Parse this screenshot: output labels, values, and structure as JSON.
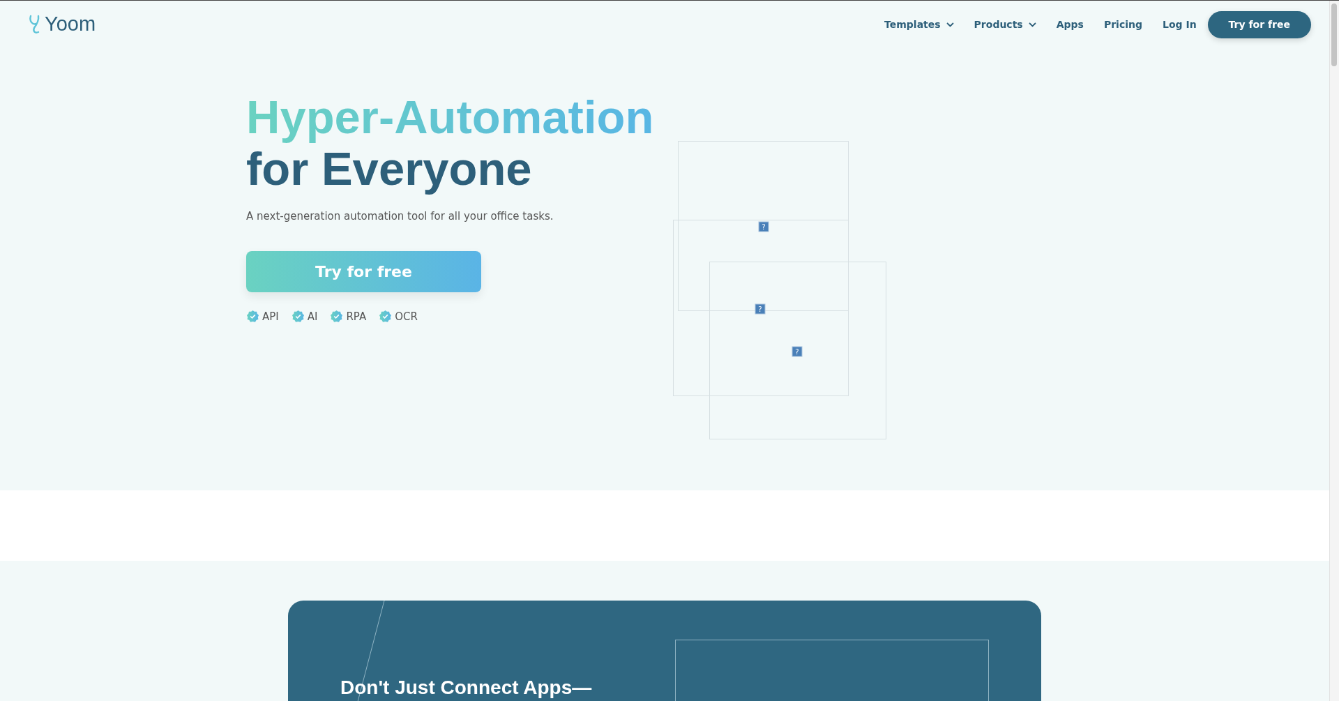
{
  "nav": {
    "logo": "Yoom",
    "links": [
      {
        "label": "Templates",
        "dropdown": true
      },
      {
        "label": "Products",
        "dropdown": true
      },
      {
        "label": "Apps",
        "dropdown": false
      },
      {
        "label": "Pricing",
        "dropdown": false
      },
      {
        "label": "Log In",
        "dropdown": false
      }
    ],
    "cta": "Try for free"
  },
  "hero": {
    "title_line1": "Hyper-Automation",
    "title_line2": "for Everyone",
    "subtitle": "A next-generation automation tool for all your office tasks.",
    "button": "Try for free",
    "features": [
      "API",
      "AI",
      "RPA",
      "OCR"
    ],
    "images": [
      {
        "kind": "broken-image",
        "label": "?"
      },
      {
        "kind": "broken-image",
        "label": "?"
      },
      {
        "kind": "broken-image",
        "label": "?"
      }
    ]
  },
  "section": {
    "heading": "Don't Just Connect Apps—"
  }
}
